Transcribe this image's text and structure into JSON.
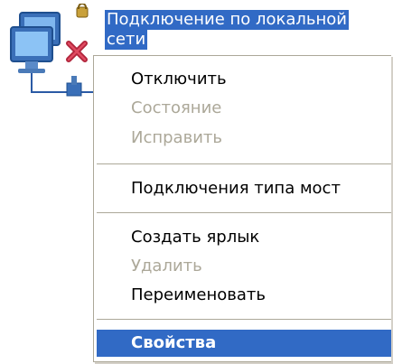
{
  "desktop_item": {
    "label_line1": "Подключение по локальной",
    "label_line2": "сети",
    "icon": "network-connection-disconnected-icon",
    "selection_color": "#316ac5"
  },
  "context_menu": {
    "items": [
      {
        "label": "Отключить",
        "enabled": true
      },
      {
        "label": "Состояние",
        "enabled": false
      },
      {
        "label": "Исправить",
        "enabled": false
      },
      {
        "label": "Подключения типа мост",
        "enabled": true
      },
      {
        "label": "Создать ярлык",
        "enabled": true
      },
      {
        "label": "Удалить",
        "enabled": false
      },
      {
        "label": "Переименовать",
        "enabled": true
      },
      {
        "label": "Свойства",
        "enabled": true,
        "default": true,
        "highlighted": true
      }
    ],
    "disabled_color": "#aca899",
    "highlight_color": "#316ac5"
  }
}
